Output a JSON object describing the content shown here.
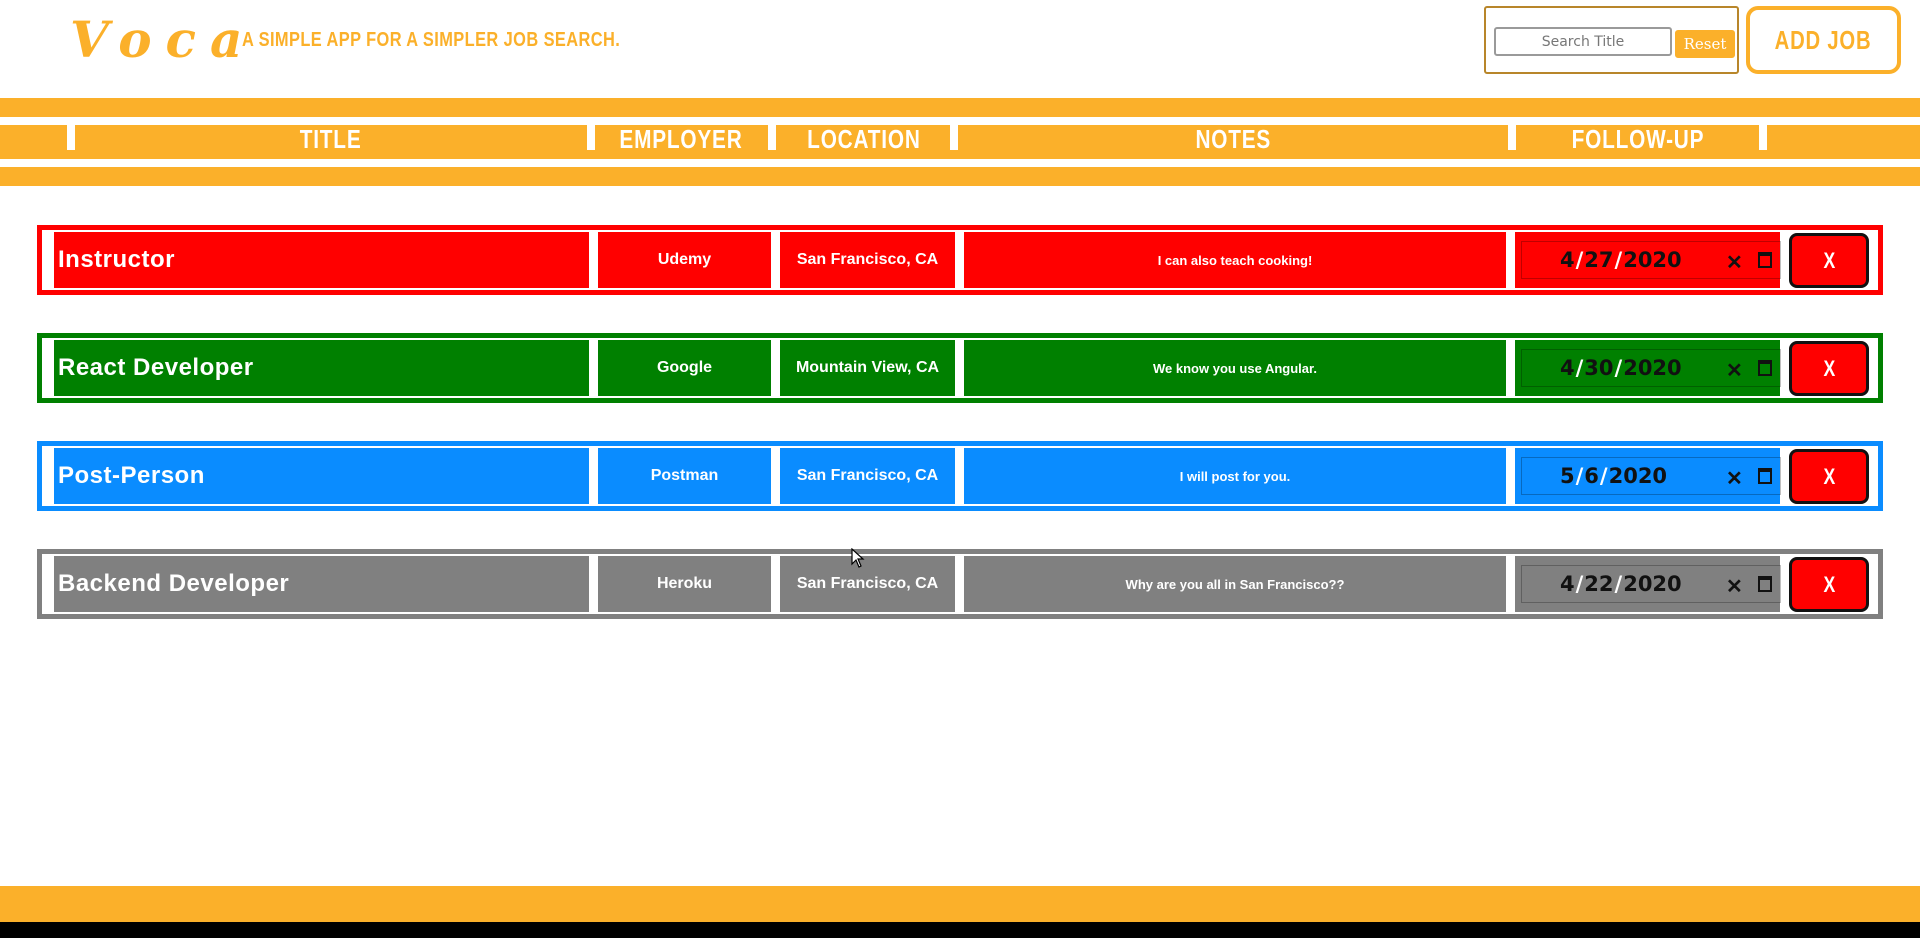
{
  "header": {
    "logo": "Voca",
    "tagline": "A SIMPLE APP FOR A SIMPLER JOB SEARCH.",
    "search_placeholder": "Search Title",
    "search_value": "",
    "reset_label": "Reset",
    "add_job_label": "ADD JOB"
  },
  "columns": {
    "title": "TITLE",
    "employer": "EMPLOYER",
    "location": "LOCATION",
    "notes": "NOTES",
    "follow_up": "FOLLOW-UP"
  },
  "jobs": [
    {
      "title": "Instructor",
      "employer": "Udemy",
      "location": "San Francisco, CA",
      "notes": "I can also teach cooking!",
      "month": "4",
      "day": "27",
      "year": "2020",
      "color": "#ff0000",
      "delete_label": "X"
    },
    {
      "title": "React Developer",
      "employer": "Google",
      "location": "Mountain View, CA",
      "notes": "We know you use Angular.",
      "month": "4",
      "day": "30",
      "year": "2020",
      "color": "#008000",
      "delete_label": "X"
    },
    {
      "title": "Post-Person",
      "employer": "Postman",
      "location": "San Francisco, CA",
      "notes": "I will post for you.",
      "month": "5",
      "day": "6",
      "year": "2020",
      "color": "#0a8cff",
      "delete_label": "X"
    },
    {
      "title": "Backend Developer",
      "employer": "Heroku",
      "location": "San Francisco, CA",
      "notes": "Why are you all in San Francisco??",
      "month": "4",
      "day": "22",
      "year": "2020",
      "color": "#808080",
      "delete_label": "X"
    }
  ],
  "theme": {
    "accent": "#fbb02a",
    "delete": "#ff0000",
    "footer_bar": "#000000"
  },
  "icons": {
    "date_clear": "close-icon",
    "date_picker": "calendar-icon",
    "pointer": "mouse-cursor-icon"
  }
}
